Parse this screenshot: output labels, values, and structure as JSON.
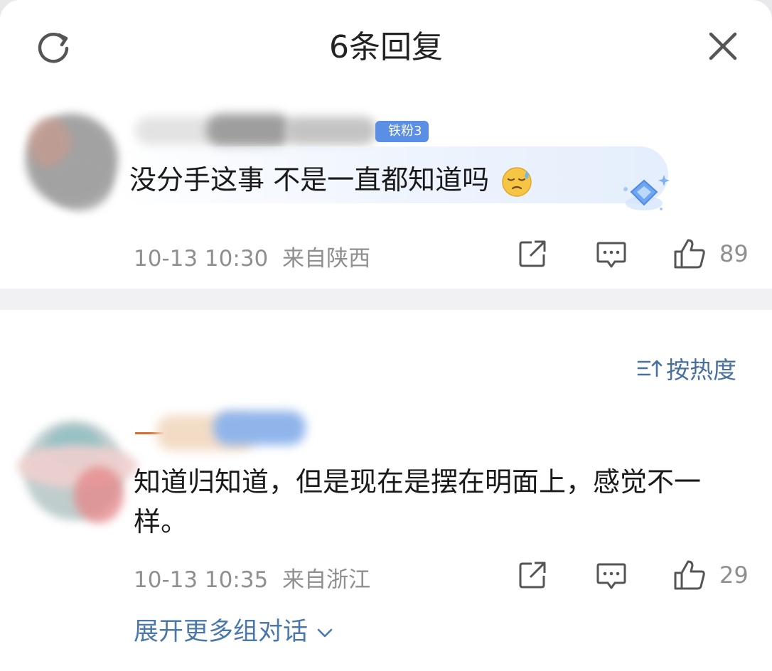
{
  "header": {
    "title": "6条回复",
    "refresh_icon": "refresh-icon",
    "close_icon": "close-icon"
  },
  "root_comment": {
    "badge": "铁粉3",
    "text": "没分手这事 不是一直都知道吗",
    "emoji": "sweat-emoji",
    "date": "10-13 10:30",
    "location": "来自陕西",
    "likes": "89"
  },
  "sort": {
    "label": "按热度",
    "icon": "sort-icon"
  },
  "reply": {
    "text": "知道归知道，但是现在是摆在明面上，感觉不一样。",
    "date": "10-13 10:35",
    "location": "来自浙江",
    "likes": "29"
  },
  "expand": {
    "label": "展开更多组对话"
  },
  "colors": {
    "link_blue": "#4a78ab",
    "meta_gray": "#8f8f8f",
    "badge_blue": "#5b8fe6"
  }
}
